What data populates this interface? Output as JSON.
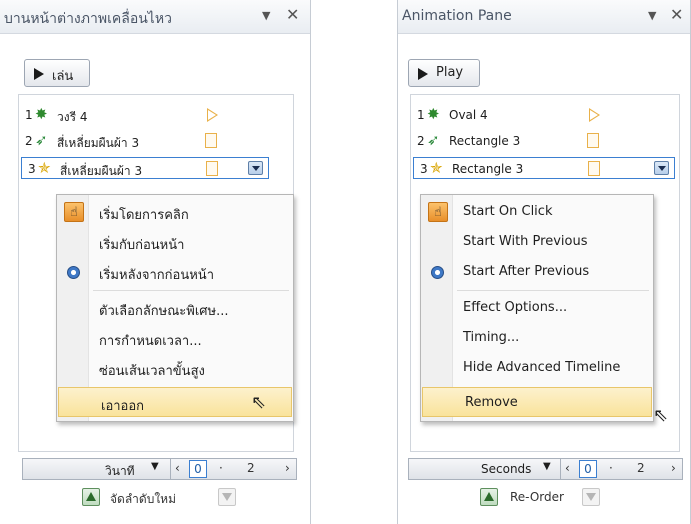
{
  "panes": [
    {
      "title": "บานหน้าต่างภาพเคลื่อนไหว",
      "play_label": "เล่น",
      "items": [
        {
          "num": "1",
          "name": "วงรี 4"
        },
        {
          "num": "2",
          "name": "สี่เหลี่ยมผืนผ้า 3"
        },
        {
          "num": "3",
          "name": "สี่เหลี่ยมผืนผ้า 3"
        }
      ],
      "menu": [
        "เริ่มโดยการคลิก",
        "เริ่มกับก่อนหน้า",
        "เริ่มหลังจากก่อนหน้า",
        "ตัวเลือกลักษณะพิเศษ...",
        "การกำหนดเวลา...",
        "ซ่อนเส้นเวลาขั้นสูง",
        "เอาออก"
      ],
      "timeline": {
        "unit": "วินาที",
        "t0": "0",
        "t1": "2"
      },
      "reorder_label": "จัดลำดับใหม่"
    },
    {
      "title": "Animation Pane",
      "play_label": "Play",
      "items": [
        {
          "num": "1",
          "name": "Oval 4"
        },
        {
          "num": "2",
          "name": "Rectangle 3"
        },
        {
          "num": "3",
          "name": "Rectangle 3"
        }
      ],
      "menu": [
        "Start On Click",
        "Start With Previous",
        "Start After Previous",
        "Effect Options...",
        "Timing...",
        "Hide Advanced Timeline",
        "Remove"
      ],
      "timeline": {
        "unit": "Seconds",
        "t0": "0",
        "t1": "2"
      },
      "reorder_label": "Re-Order"
    }
  ],
  "icons": {
    "chevron": "chevron-down-icon",
    "close": "close-icon",
    "play": "play-icon",
    "emphasis_star": "emphasis-star-icon",
    "motion_path": "motion-path-icon",
    "entrance_star": "entrance-star-icon",
    "on_click": "mouse-click-icon",
    "after_previous": "clock-icon",
    "cursor": "mouse-pointer-icon"
  },
  "colors": {
    "selection_border": "#3b7fd1",
    "menu_highlight": "#f9e39b",
    "timing_marker": "#e9b14a"
  }
}
